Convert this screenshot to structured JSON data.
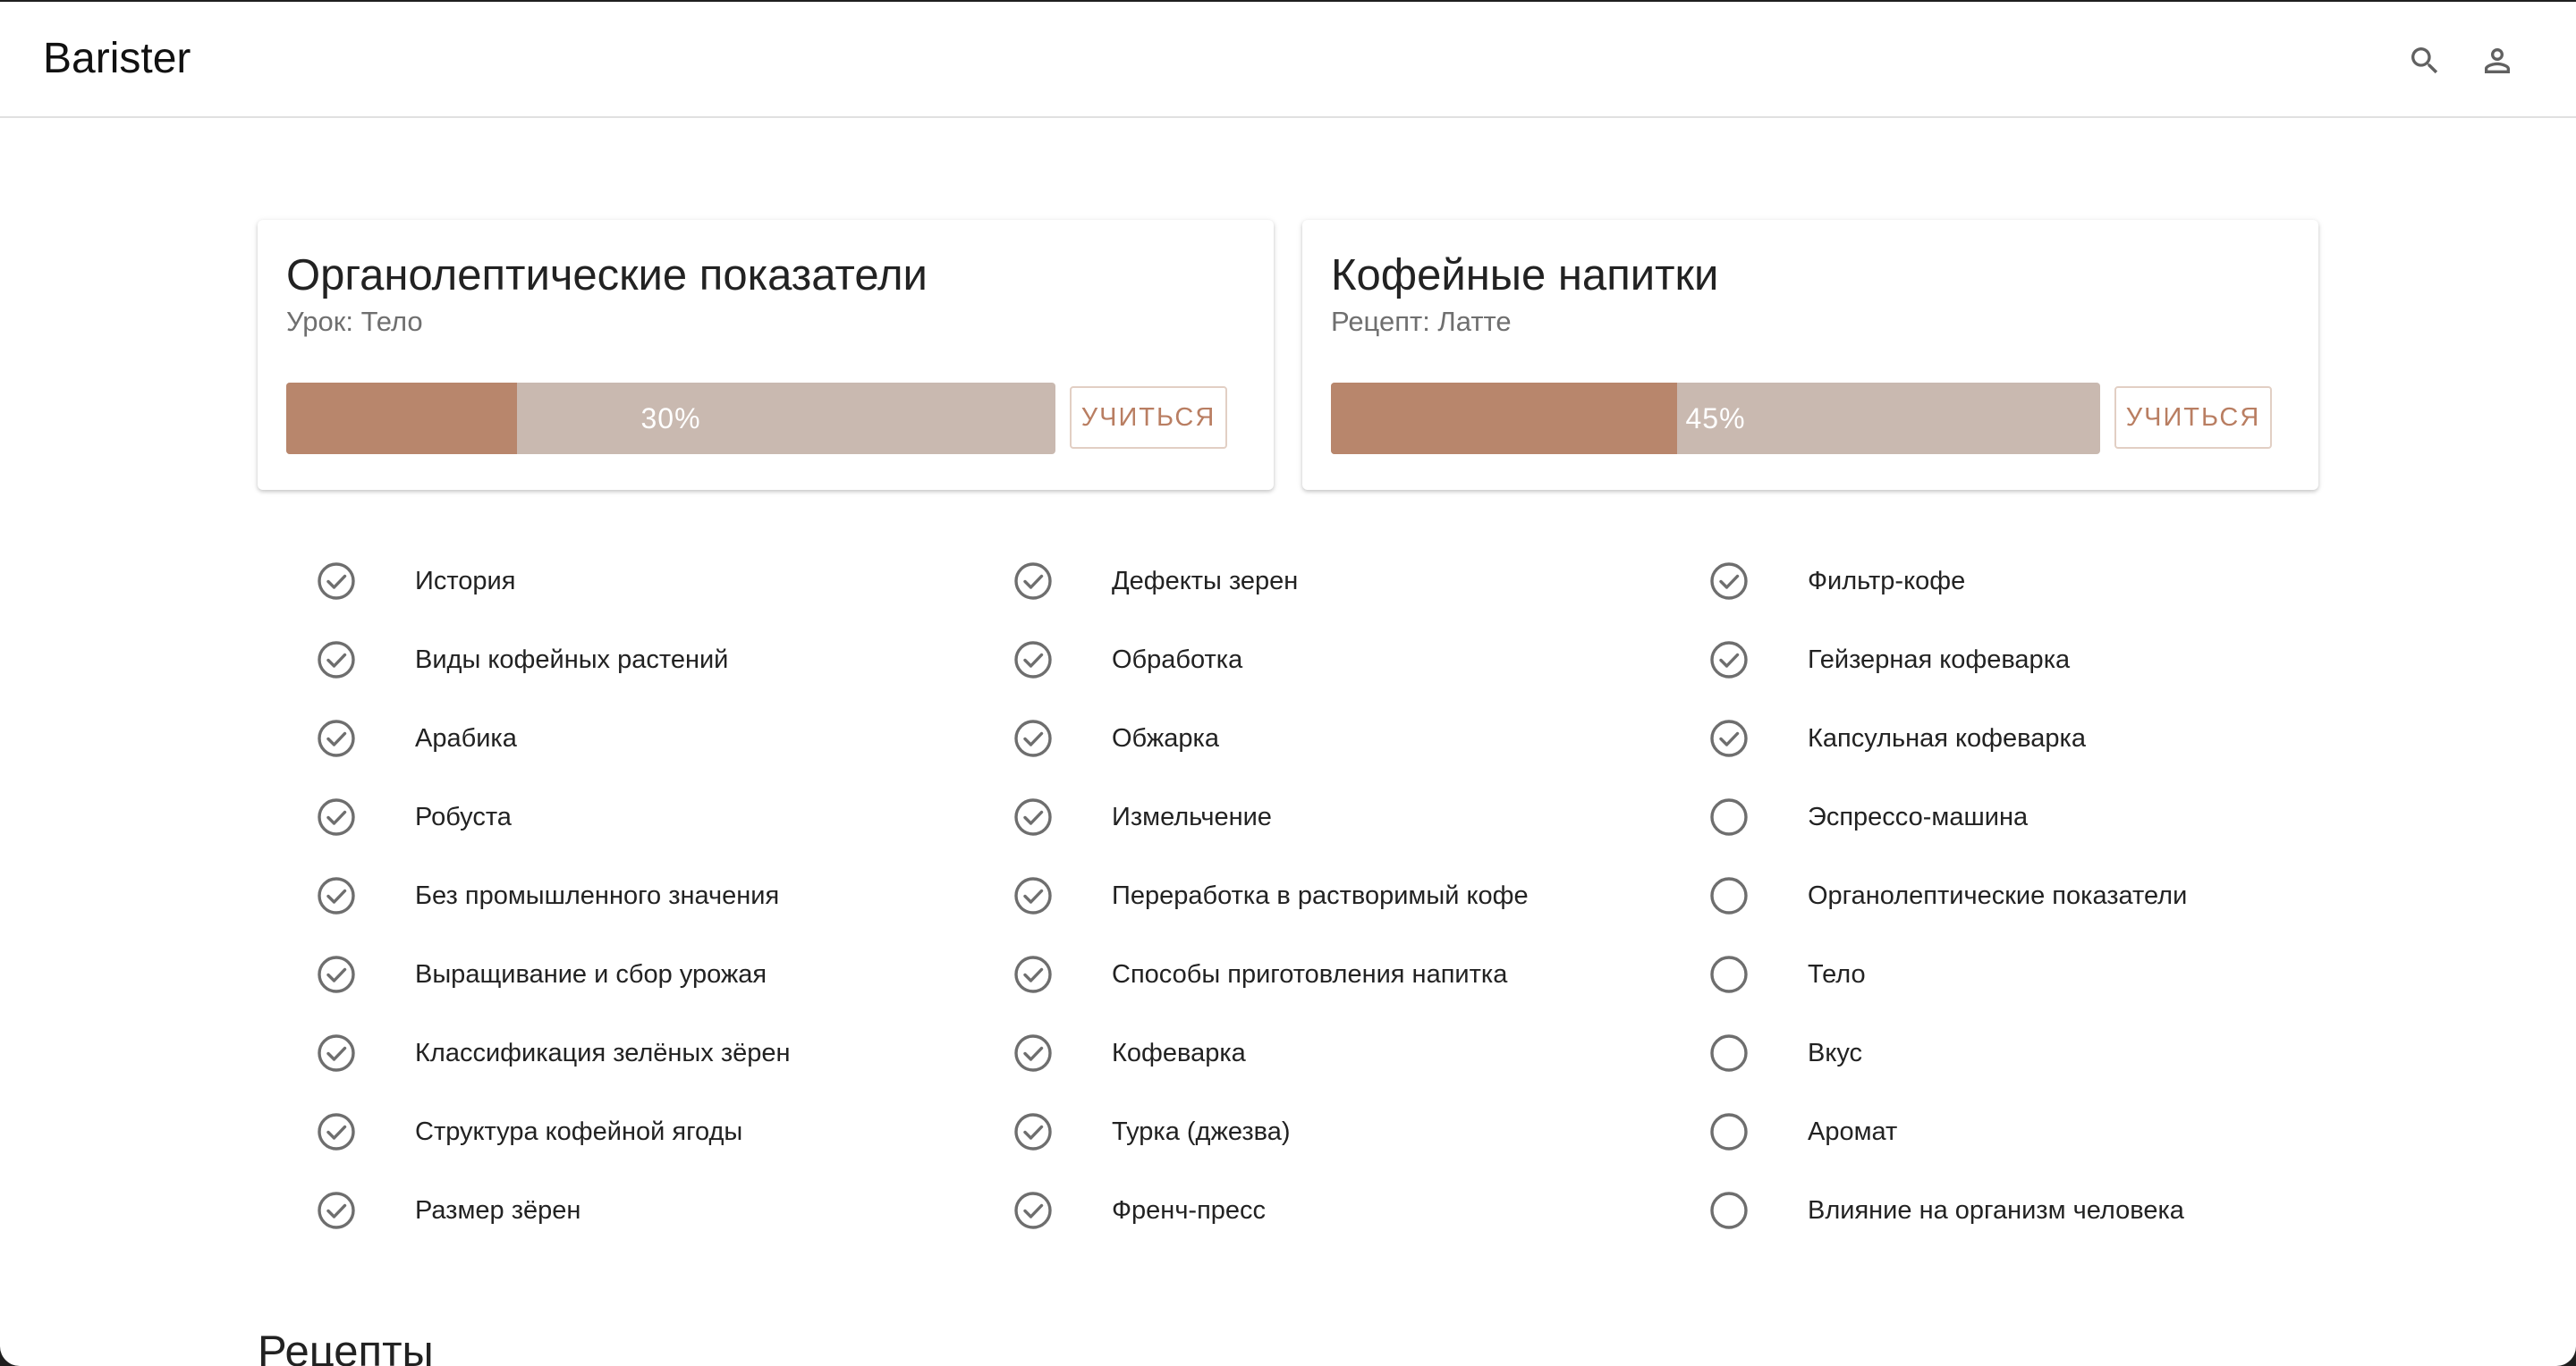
{
  "app": {
    "title": "Barister",
    "search_icon": "search-icon",
    "account_icon": "account-icon"
  },
  "colors": {
    "progress_fill": "#b8866c",
    "progress_track": "#c9b9b0",
    "accent_text": "#b97e62",
    "check_icon": "#6e6e6e"
  },
  "cards": [
    {
      "title": "Органолептические показатели",
      "subtitle": "Урок: Тело",
      "progress": 30,
      "progress_label": "30%",
      "button_label": "УЧИТЬСЯ"
    },
    {
      "title": "Кофейные напитки",
      "subtitle": "Рецепт: Латте",
      "progress": 45,
      "progress_label": "45%",
      "button_label": "УЧИТЬСЯ"
    }
  ],
  "topics": {
    "col1": [
      {
        "label": "История",
        "done": true
      },
      {
        "label": "Виды кофейных растений",
        "done": true
      },
      {
        "label": "Арабика",
        "done": true
      },
      {
        "label": "Робуста",
        "done": true
      },
      {
        "label": "Без промышленного значения",
        "done": true
      },
      {
        "label": "Выращивание и сбор урожая",
        "done": true
      },
      {
        "label": "Классификация зелёных зёрен",
        "done": true
      },
      {
        "label": "Структура кофейной ягоды",
        "done": true
      },
      {
        "label": "Размер зёрен",
        "done": true
      }
    ],
    "col2": [
      {
        "label": "Дефекты зерен",
        "done": true
      },
      {
        "label": "Обработка",
        "done": true
      },
      {
        "label": "Обжарка",
        "done": true
      },
      {
        "label": "Измельчение",
        "done": true
      },
      {
        "label": "Переработка в растворимый кофе",
        "done": true
      },
      {
        "label": "Способы приготовления напитка",
        "done": true
      },
      {
        "label": "Кофеварка",
        "done": true
      },
      {
        "label": "Турка (джезва)",
        "done": true
      },
      {
        "label": "Френч-пресс",
        "done": true
      }
    ],
    "col3": [
      {
        "label": "Фильтр-кофе",
        "done": true
      },
      {
        "label": "Гейзерная кофеварка",
        "done": true
      },
      {
        "label": "Капсульная кофеварка",
        "done": true
      },
      {
        "label": "Эспрессо-машина",
        "done": false
      },
      {
        "label": "Органолептические показатели",
        "done": false
      },
      {
        "label": "Тело",
        "done": false
      },
      {
        "label": "Вкус",
        "done": false
      },
      {
        "label": "Аромат",
        "done": false
      },
      {
        "label": "Влияние на организм человека",
        "done": false
      }
    ]
  },
  "sections": {
    "recipes_title": "Рецепты"
  }
}
